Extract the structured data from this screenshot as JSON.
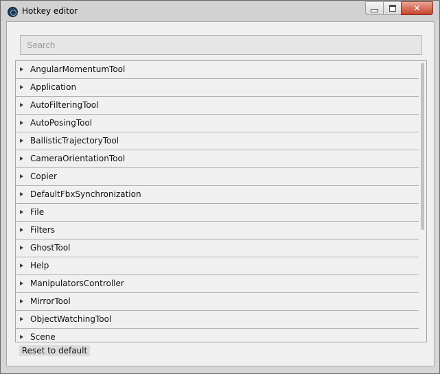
{
  "window": {
    "title": "Hotkey editor",
    "app_icon": "app-logo-icon",
    "close_glyph": "✕"
  },
  "search": {
    "placeholder": "Search",
    "value": ""
  },
  "categories": [
    "AngularMomentumTool",
    "Application",
    "AutoFilteringTool",
    "AutoPosingTool",
    "BallisticTrajectoryTool",
    "CameraOrientationTool",
    "Copier",
    "DefaultFbxSynchronization",
    "File",
    "Filters",
    "GhostTool",
    "Help",
    "ManipulatorsController",
    "MirrorTool",
    "ObjectWatchingTool",
    "Scene"
  ],
  "footer": {
    "reset_label": "Reset to default"
  },
  "colors": {
    "close_button": "#c7432b",
    "window_bg": "#f0f0f0"
  }
}
